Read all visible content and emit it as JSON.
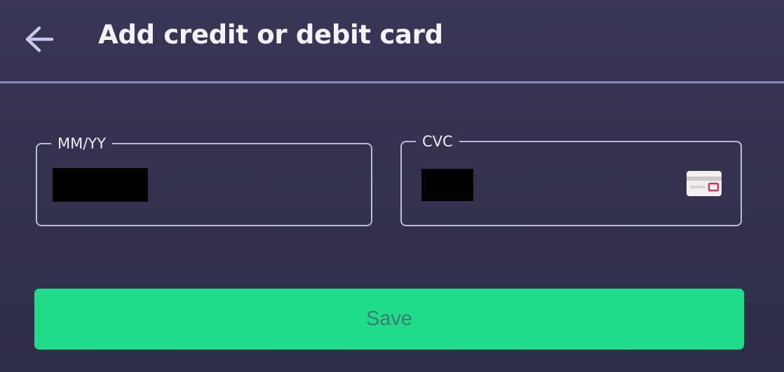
{
  "header": {
    "title": "Add credit or debit card",
    "back_icon": "arrow-left-icon"
  },
  "form": {
    "expiry": {
      "label": "MM/YY",
      "value_state": "redacted"
    },
    "cvc": {
      "label": "CVC",
      "value_state": "redacted",
      "icon": "card-cvc-icon"
    }
  },
  "actions": {
    "save_label": "Save"
  },
  "colors": {
    "background": "#34324f",
    "divider": "#8b89b4",
    "field_border": "#bcbbdb",
    "accent": "#1fdb8a",
    "button_text": "#3e7e6e",
    "title_text": "#f4f3fb"
  }
}
